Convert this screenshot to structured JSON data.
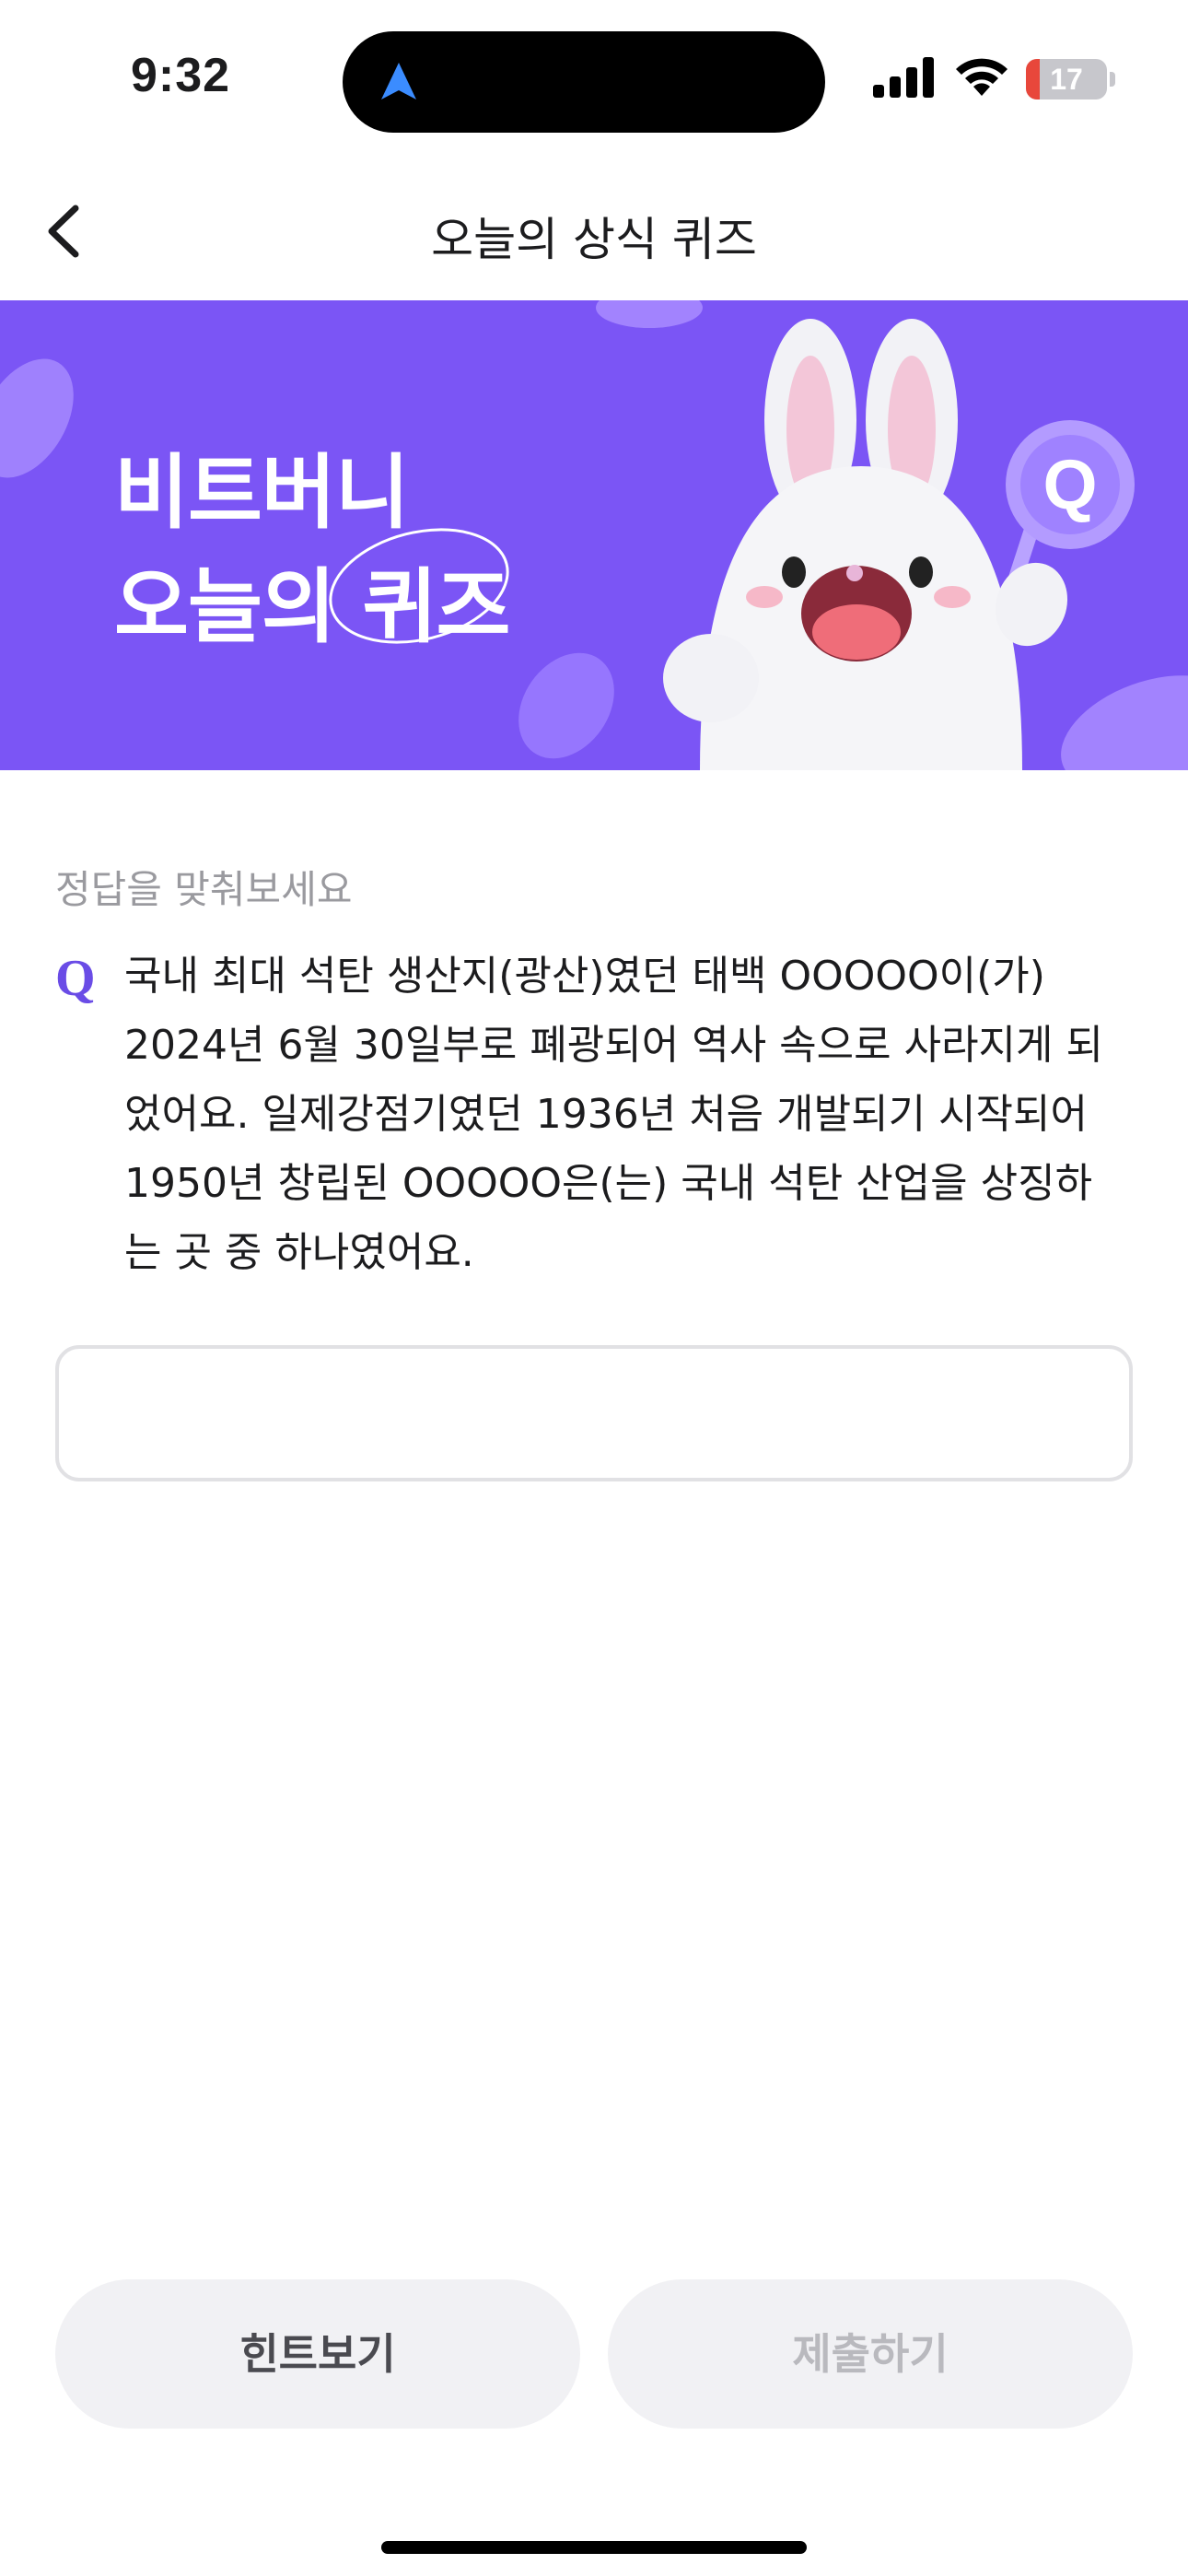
{
  "status_bar": {
    "time": "9:32",
    "battery_level": "17",
    "battery_fraction": 0.17,
    "icons": [
      "location-arrow-icon",
      "cellular-signal-icon",
      "wifi-icon",
      "battery-icon"
    ]
  },
  "nav": {
    "back_icon": "chevron-left-icon",
    "title": "오늘의 상식 퀴즈"
  },
  "banner": {
    "line1": "비트버니",
    "line2": "오늘의 퀴즈",
    "badge_letter": "Q",
    "background_color": "#7b55f5"
  },
  "quiz": {
    "prompt_label": "정답을 맞춰보세요",
    "q_mark": "Q",
    "question": "국내 최대 석탄 생산지(광산)였던 태백 OOOOO이(가) 2024년 6월 30일부로 폐광되어 역사 속으로 사라지게 되었어요. 일제강점기였던 1936년 처음 개발되기 시작되어 1950년 창립된 OOOOO은(는) 국내 석탄 산업을 상징하는 곳 중 하나였어요.",
    "answer_value": "",
    "accent_color": "#6a4ce6"
  },
  "buttons": {
    "hint_label": "힌트보기",
    "submit_label": "제출하기"
  }
}
